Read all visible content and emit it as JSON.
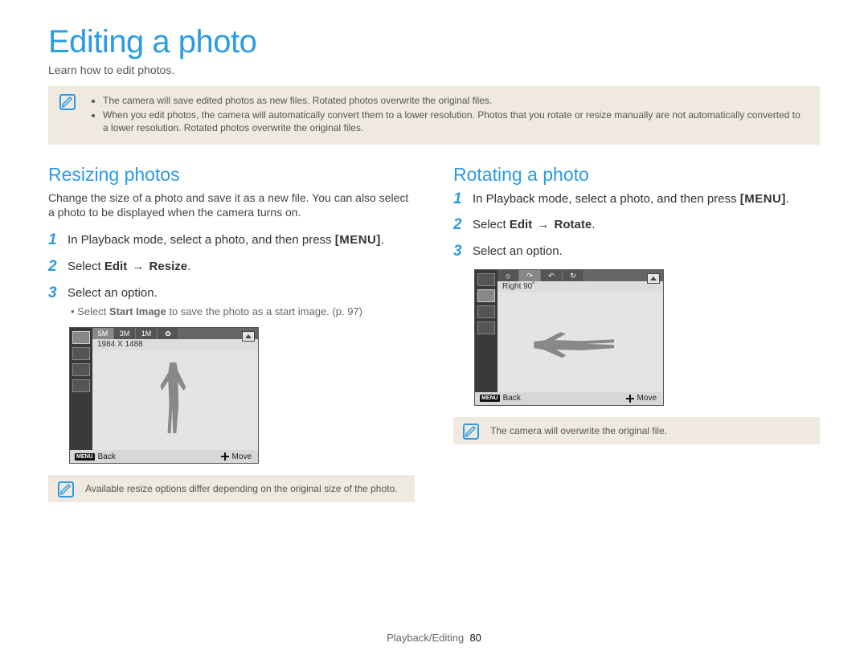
{
  "page_title": "Editing a photo",
  "subtitle": "Learn how to edit photos.",
  "top_note": {
    "bullets": [
      "The camera will save edited photos as new files. Rotated photos overwrite the original files.",
      "When you edit photos, the camera will automatically convert them to a lower resolution. Photos that you rotate or resize manually are not automatically converted to a lower resolution. Rotated photos overwrite the original files."
    ]
  },
  "left": {
    "heading": "Resizing photos",
    "desc": "Change the size of a photo and save it as a new file. You can also select a photo to be displayed when the camera turns on.",
    "step1_a": "In Playback mode, select a photo, and then press ",
    "step1_menu": "[MENU]",
    "step1_b": ".",
    "step2_a": "Select ",
    "step2_b": "Edit",
    "step2_arrow": " → ",
    "step2_c": "Resize",
    "step2_d": ".",
    "step3": "Select an option.",
    "step3_sub_a": "Select ",
    "step3_sub_b": "Start Image",
    "step3_sub_c": " to save the photo as a start image. (p. 97)",
    "screen": {
      "opt1": "5M",
      "opt2": "3M",
      "opt3": "1M",
      "opt_label": "1984 X 1488",
      "back_label": "Back",
      "move_label": "Move",
      "menu_small": "MENU"
    },
    "note": "Available resize options differ depending on the original size of the photo."
  },
  "right": {
    "heading": "Rotating a photo",
    "step1_a": "In Playback mode, select a photo, and then press ",
    "step1_menu": "[MENU]",
    "step1_b": ".",
    "step2_a": "Select ",
    "step2_b": "Edit",
    "step2_arrow": " → ",
    "step2_c": "Rotate",
    "step2_d": ".",
    "step3": "Select an option.",
    "screen": {
      "opt_label": "Right 90˚",
      "back_label": "Back",
      "move_label": "Move",
      "menu_small": "MENU"
    },
    "note": "The camera will overwrite the original file."
  },
  "footer": {
    "section": "Playback/Editing",
    "page": "80"
  }
}
